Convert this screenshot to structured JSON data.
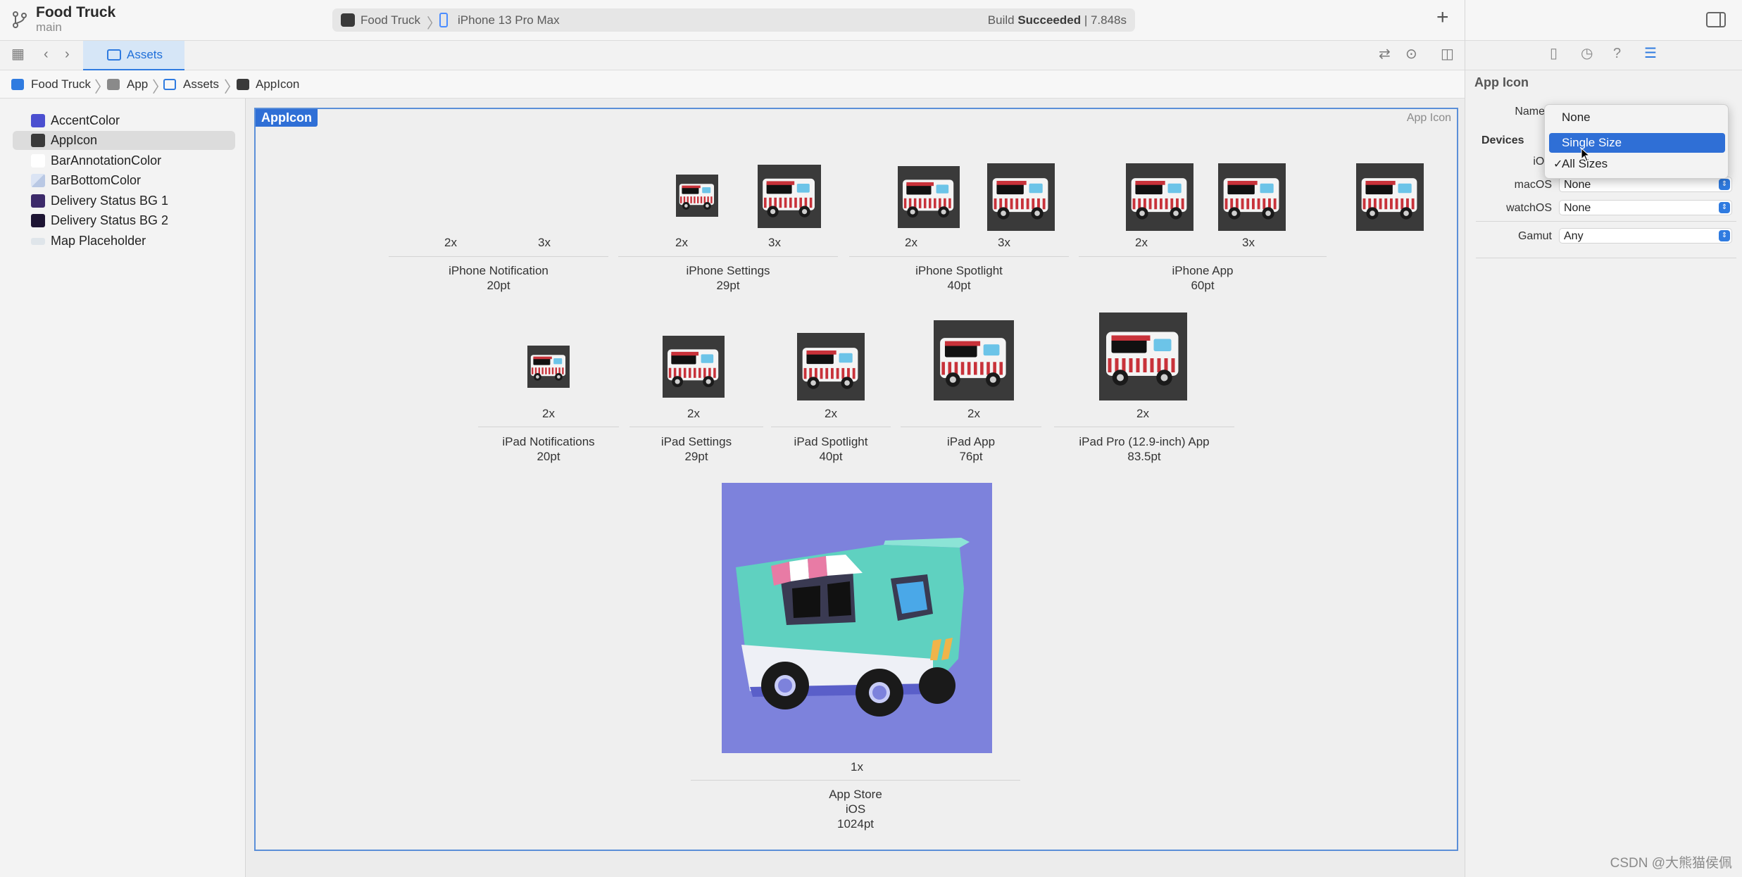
{
  "toolbar": {
    "project": "Food Truck",
    "branch": "main",
    "scheme": "Food Truck",
    "device": "iPhone 13 Pro Max",
    "build_status_prefix": "Build ",
    "build_status_bold": "Succeeded",
    "build_status_suffix": " | 7.848s",
    "add_label": "+"
  },
  "tabbar": {
    "active_tab": "Assets"
  },
  "jumpbar": {
    "items": [
      "Food Truck",
      "App",
      "Assets",
      "AppIcon"
    ]
  },
  "navigator": {
    "items": [
      {
        "label": "AccentColor",
        "color": "#4b4fd0"
      },
      {
        "label": "AppIcon",
        "color": "#3a3a3a"
      },
      {
        "label": "BarAnnotationColor",
        "color": "#ffffff"
      },
      {
        "label": "BarBottomColor",
        "color": "#b9c8e4"
      },
      {
        "label": "Delivery Status BG 1",
        "color": "#3c2a6a"
      },
      {
        "label": "Delivery Status BG 2",
        "color": "#1d1433"
      },
      {
        "label": "Map Placeholder",
        "color": "#dfe5ea"
      }
    ]
  },
  "editor": {
    "set_name": "AppIcon",
    "set_type": "App Icon",
    "iphone_groups": [
      {
        "name": "iPhone Notification",
        "size": "20pt",
        "scales": [
          "2x",
          "3x"
        ]
      },
      {
        "name": "iPhone Settings",
        "size": "29pt",
        "scales": [
          "2x",
          "3x"
        ]
      },
      {
        "name": "iPhone Spotlight",
        "size": "40pt",
        "scales": [
          "2x",
          "3x"
        ]
      },
      {
        "name": "iPhone App",
        "size": "60pt",
        "scales": [
          "2x",
          "3x"
        ]
      }
    ],
    "ipad_groups": [
      {
        "name": "iPad Notifications",
        "size": "20pt",
        "scale": "2x"
      },
      {
        "name": "iPad Settings",
        "size": "29pt",
        "scale": "2x"
      },
      {
        "name": "iPad Spotlight",
        "size": "40pt",
        "scale": "2x"
      },
      {
        "name": "iPad App",
        "size": "76pt",
        "scale": "2x"
      },
      {
        "name": "iPad Pro (12.9-inch) App",
        "size": "83.5pt",
        "scale": "2x"
      }
    ],
    "appstore": {
      "scale": "1x",
      "name": "App Store",
      "platform": "iOS",
      "size": "1024pt"
    }
  },
  "inspector": {
    "title": "App Icon",
    "name_label": "Name",
    "devices_section": "Devices",
    "ios_label": "iOS",
    "macos_label": "macOS",
    "macos_value": "None",
    "watchos_label": "watchOS",
    "watchos_value": "None",
    "gamut_label": "Gamut",
    "gamut_value": "Any"
  },
  "menu": {
    "items": [
      "None",
      "Single Size",
      "All Sizes"
    ],
    "highlighted": "Single Size",
    "checked": "All Sizes",
    "check_glyph": "✓"
  },
  "watermark": "CSDN @大熊猫侯佩",
  "colors": {
    "accent": "#2f7be0",
    "selection": "#2f6fd6",
    "icon_bg": "#3a3a3a",
    "appstore_bg": "#7d82dc"
  }
}
